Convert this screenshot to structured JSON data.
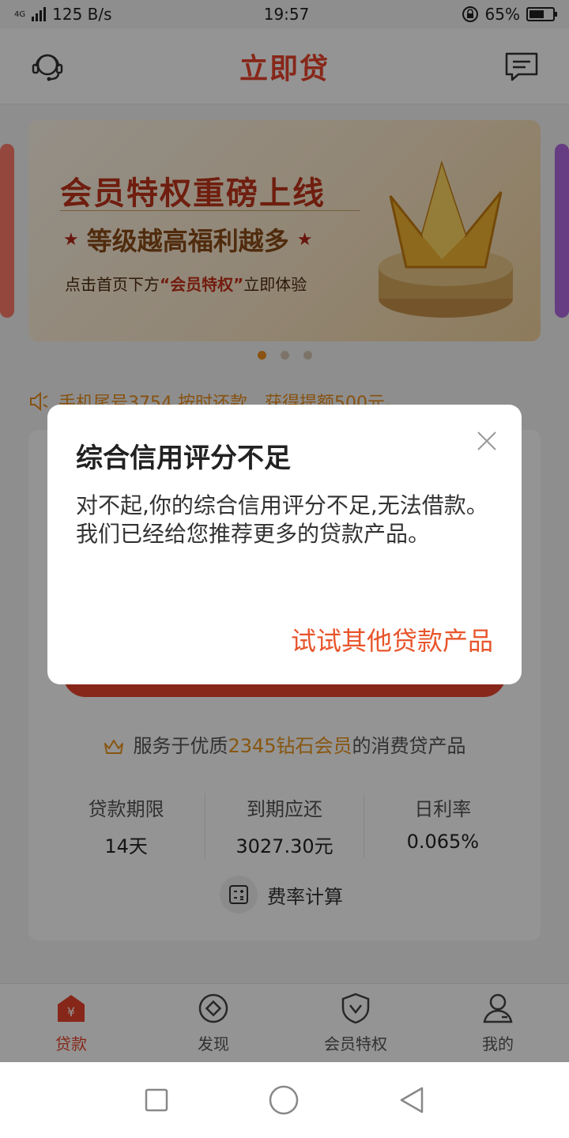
{
  "status_bar": {
    "network": "4G",
    "speed": "125 B/s",
    "time": "19:57",
    "battery_pct": "65%",
    "battery_level": 0.65
  },
  "header": {
    "title": "立即贷",
    "left_icon": "customer-service-icon",
    "right_icon": "message-icon"
  },
  "banner": {
    "title": "会员特权重磅上线",
    "subtitle": "等级越高福利越多",
    "tip_prefix": "点击首页下方",
    "tip_highlight": "“会员特权”",
    "tip_suffix": "立即体验",
    "page_count": 3,
    "active_index": 0
  },
  "notice": {
    "text": "手机尾号3754 按时还款，获得提额500元。"
  },
  "card": {
    "member_prefix": "服务于优质",
    "member_highlight": "2345钻石会员",
    "member_suffix": "的消费贷产品",
    "stats": [
      {
        "label": "贷款期限",
        "value": "14天"
      },
      {
        "label": "到期应还",
        "value": "3027.30元"
      },
      {
        "label": "日利率",
        "value": "0.065%"
      }
    ],
    "calc_label": "费率计算"
  },
  "tabs": [
    {
      "label": "贷款",
      "icon": "loan-icon",
      "active": true
    },
    {
      "label": "发现",
      "icon": "discover-icon",
      "active": false
    },
    {
      "label": "会员特权",
      "icon": "shield-icon",
      "active": false
    },
    {
      "label": "我的",
      "icon": "profile-icon",
      "active": false
    }
  ],
  "dialog": {
    "title": "综合信用评分不足",
    "message": "对不起,你的综合信用评分不足,无法借款。我们已经给您推荐更多的贷款产品。",
    "action": "试试其他贷款产品"
  },
  "colors": {
    "brand": "#e8442b",
    "accent": "#e8941c"
  }
}
